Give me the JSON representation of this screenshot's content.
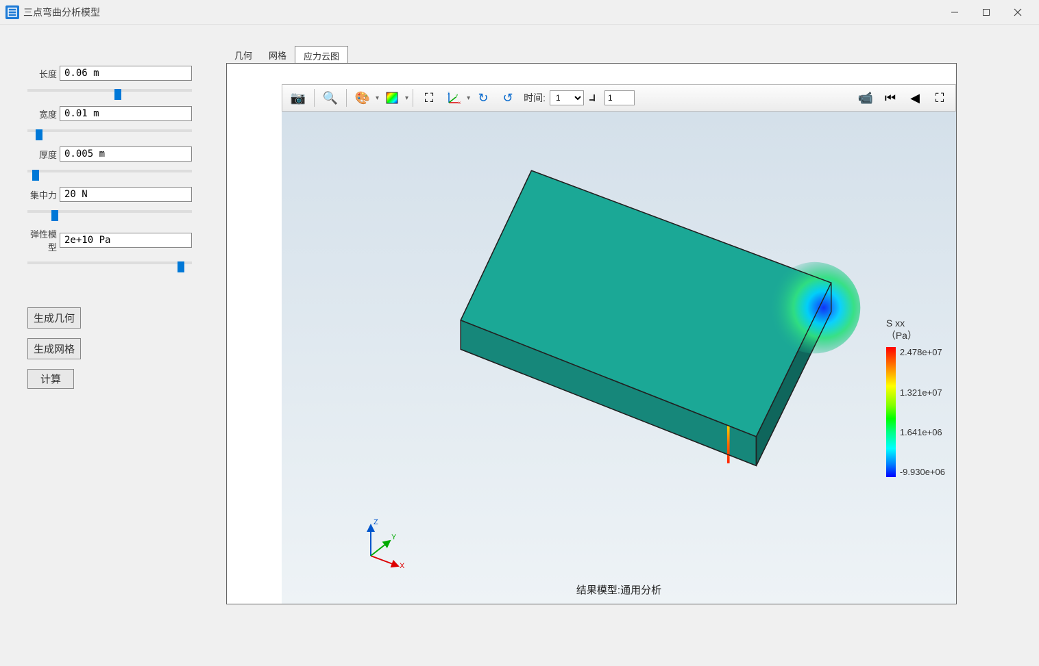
{
  "window": {
    "title": "三点弯曲分析模型"
  },
  "sidebar": {
    "fields": {
      "length": {
        "label": "长度",
        "value": "0.06 m"
      },
      "width": {
        "label": "宽度",
        "value": "0.01 m"
      },
      "thickness": {
        "label": "厚度",
        "value": "0.005 m"
      },
      "force": {
        "label": "集中力",
        "value": "20 N"
      },
      "modulus": {
        "label": "弹性模型",
        "value": "2e+10 Pa"
      }
    },
    "buttons": {
      "gen_geom": "生成几何",
      "gen_mesh": "生成网格",
      "compute": "计算"
    }
  },
  "tabs": {
    "geom": "几何",
    "mesh": "网格",
    "stress": "应力云图"
  },
  "toolbar": {
    "time_label": "时间:",
    "time_select": "1",
    "time_spin": "1"
  },
  "legend": {
    "title_line1": "S xx",
    "title_line2": "（Pa）",
    "ticks": {
      "t0": "2.478e+07",
      "t1": "1.321e+07",
      "t2": "1.641e+06",
      "t3": "-9.930e+06"
    }
  },
  "result_label": "结果模型:通用分析",
  "axes": {
    "x": "X",
    "y": "Y",
    "z": "Z"
  },
  "icons": {
    "camera": "📷",
    "zoom": "🔍",
    "palette": "🎨",
    "cube": "🧊",
    "extents": "⛶",
    "triad": "✛",
    "rotate_cw": "↻",
    "rotate_ccw": "↺",
    "video": "📹",
    "first": "⏮",
    "prev": "◀",
    "expand": "⛶"
  }
}
